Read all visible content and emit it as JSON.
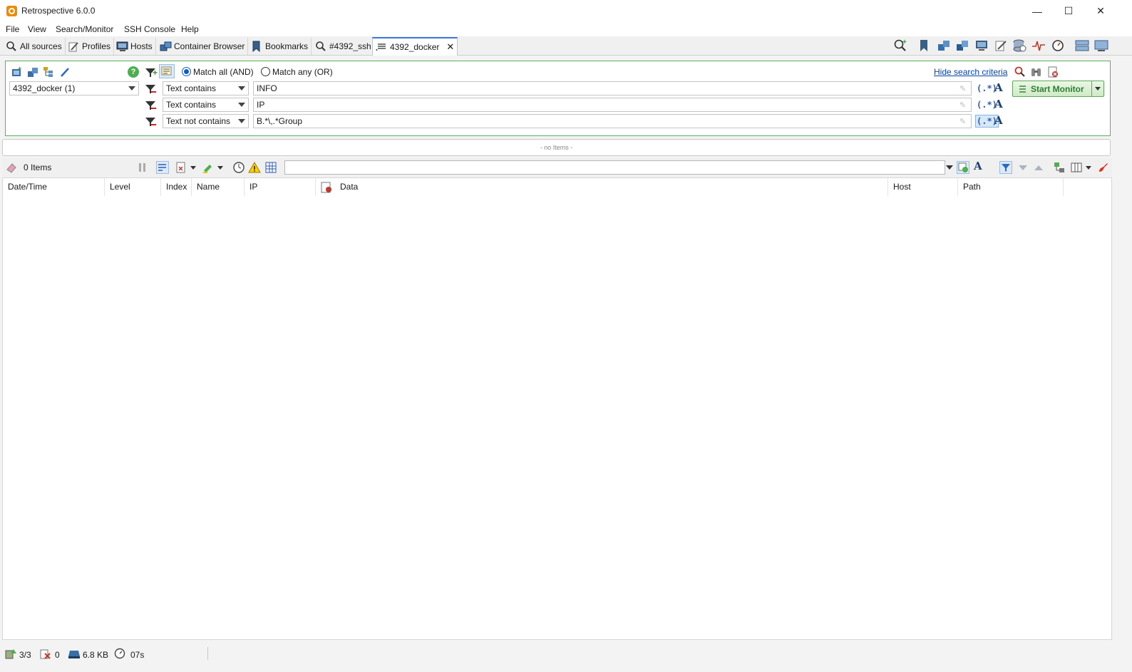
{
  "window": {
    "title": "Retrospective 6.0.0",
    "minimize_glyph": "—",
    "maximize_glyph": "☐",
    "close_glyph": "✕"
  },
  "menu": [
    "File",
    "View",
    "Search/Monitor",
    "SSH Console",
    "Help"
  ],
  "tabs": [
    {
      "label": "All sources",
      "icon": "magnifier-icon"
    },
    {
      "label": "Profiles",
      "icon": "profile-icon"
    },
    {
      "label": "Hosts",
      "icon": "host-icon"
    },
    {
      "label": "Container Browser",
      "icon": "container-icon"
    },
    {
      "label": "Bookmarks",
      "icon": "bookmark-icon"
    },
    {
      "label": "#4392_ssh",
      "icon": "magnifier-icon"
    },
    {
      "label": "4392_docker",
      "icon": "list-icon",
      "active": true,
      "close": "✕"
    }
  ],
  "search": {
    "source": "4392_docker (1)",
    "help_glyph": "?",
    "match_all_label": "Match all (AND)",
    "match_any_label": "Match any (OR)",
    "match_mode": "all",
    "hide_link": "Hide search criteria",
    "criteria": [
      {
        "condition": "Text contains",
        "value": "INFO",
        "regex_glyph": "(.*)",
        "regex_active": false
      },
      {
        "condition": "Text contains",
        "value": "IP",
        "regex_glyph": "(.*)",
        "regex_active": false
      },
      {
        "condition": "Text not contains",
        "value": "B.*\\,.*Group",
        "regex_glyph": "(.*)",
        "regex_active": true
      }
    ],
    "font_glyph": "A",
    "start_button": "Start Monitor"
  },
  "histogram": {
    "empty_text": "- no Items -"
  },
  "results": {
    "count": "0 Items",
    "filter_value": "",
    "font_glyph": "A",
    "columns": [
      "Date/Time",
      "Level",
      "Index",
      "Name",
      "IP",
      "Data",
      "Host",
      "Path"
    ]
  },
  "status": {
    "sources": "3/3",
    "errors": "0",
    "size": "6.8 KB",
    "elapsed": "07s"
  },
  "colors": {
    "accent": "#3b78d8",
    "panel_border": "#59b35a",
    "start_green": "#2e7d32"
  }
}
